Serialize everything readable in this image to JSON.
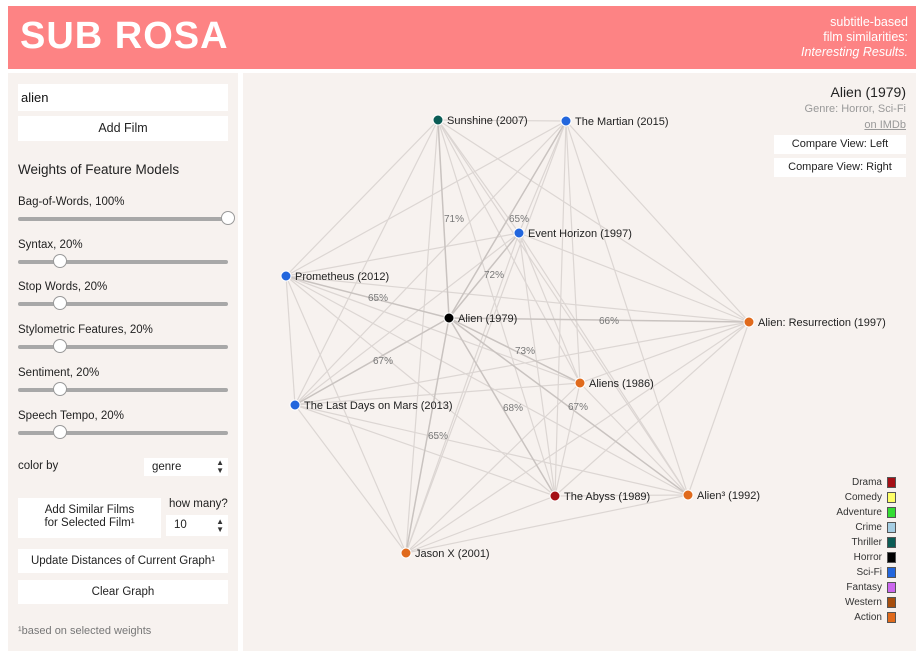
{
  "header": {
    "title": "SUB ROSA",
    "tagline_line1": "subtitle-based",
    "tagline_line2": "film similarities:",
    "tagline_line3": "Interesting Results."
  },
  "sidebar": {
    "film_input_value": "alien",
    "add_film_label": "Add Film",
    "weights_title": "Weights of Feature Models",
    "sliders": [
      {
        "label": "Bag-of-Words, 100%",
        "value": 1.0
      },
      {
        "label": "Syntax, 20%",
        "value": 0.2
      },
      {
        "label": "Stop Words, 20%",
        "value": 0.2
      },
      {
        "label": "Stylometric Features, 20%",
        "value": 0.2
      },
      {
        "label": "Sentiment, 20%",
        "value": 0.2
      },
      {
        "label": "Speech Tempo, 20%",
        "value": 0.2
      }
    ],
    "color_by_label": "color by",
    "color_by_value": "genre",
    "add_similar_line1": "Add Similar Films",
    "add_similar_line2": "for Selected Film¹",
    "how_many_label": "how many?",
    "how_many_value": "10",
    "update_label": "Update Distances of Current Graph¹",
    "clear_label": "Clear Graph",
    "footnote": "¹based on selected weights"
  },
  "info": {
    "title": "Alien (1979)",
    "genre": "Genre: Horror, Sci-Fi",
    "imdb": "on IMDb",
    "compare_left": "Compare View: Left",
    "compare_right": "Compare View: Right"
  },
  "graph": {
    "nodes": [
      {
        "id": "sunshine",
        "label": "Sunshine (2007)",
        "genre": "Thriller"
      },
      {
        "id": "martian",
        "label": "The Martian (2015)",
        "genre": "Sci-Fi"
      },
      {
        "id": "event",
        "label": "Event Horizon (1997)",
        "genre": "Sci-Fi"
      },
      {
        "id": "prometheus",
        "label": "Prometheus (2012)",
        "genre": "Sci-Fi"
      },
      {
        "id": "alien",
        "label": "Alien (1979)",
        "genre": "Horror"
      },
      {
        "id": "resurrection",
        "label": "Alien: Resurrection (1997)",
        "genre": "Action"
      },
      {
        "id": "aliens",
        "label": "Aliens (1986)",
        "genre": "Action"
      },
      {
        "id": "lastdays",
        "label": "The Last Days on Mars (2013)",
        "genre": "Sci-Fi"
      },
      {
        "id": "abyss",
        "label": "The Abyss (1989)",
        "genre": "Drama"
      },
      {
        "id": "alien3",
        "label": "Alien³ (1992)",
        "genre": "Action"
      },
      {
        "id": "jasonx",
        "label": "Jason X (2001)",
        "genre": "Action"
      }
    ],
    "labeled_edges": [
      {
        "from": "alien",
        "to": "sunshine",
        "label": "71%"
      },
      {
        "from": "alien",
        "to": "martian",
        "label": "65%"
      },
      {
        "from": "alien",
        "to": "event",
        "label": "72%"
      },
      {
        "from": "alien",
        "to": "prometheus",
        "label": "65%"
      },
      {
        "from": "alien",
        "to": "resurrection",
        "label": "66%"
      },
      {
        "from": "alien",
        "to": "aliens",
        "label": "73%"
      },
      {
        "from": "alien",
        "to": "lastdays",
        "label": "67%"
      },
      {
        "from": "alien",
        "to": "abyss",
        "label": "68%"
      },
      {
        "from": "alien",
        "to": "alien3",
        "label": "67%"
      },
      {
        "from": "alien",
        "to": "jasonx",
        "label": "65%"
      }
    ]
  },
  "legend": [
    {
      "label": "Drama",
      "color": "#a50f15"
    },
    {
      "label": "Comedy",
      "color": "#ffff66"
    },
    {
      "label": "Adventure",
      "color": "#33dd33"
    },
    {
      "label": "Crime",
      "color": "#a6cee3"
    },
    {
      "label": "Thriller",
      "color": "#0b5c55"
    },
    {
      "label": "Horror",
      "color": "#000000"
    },
    {
      "label": "Sci-Fi",
      "color": "#2266dd"
    },
    {
      "label": "Fantasy",
      "color": "#cc66ee"
    },
    {
      "label": "Western",
      "color": "#a64e0e"
    },
    {
      "label": "Action",
      "color": "#e06a1c"
    }
  ]
}
